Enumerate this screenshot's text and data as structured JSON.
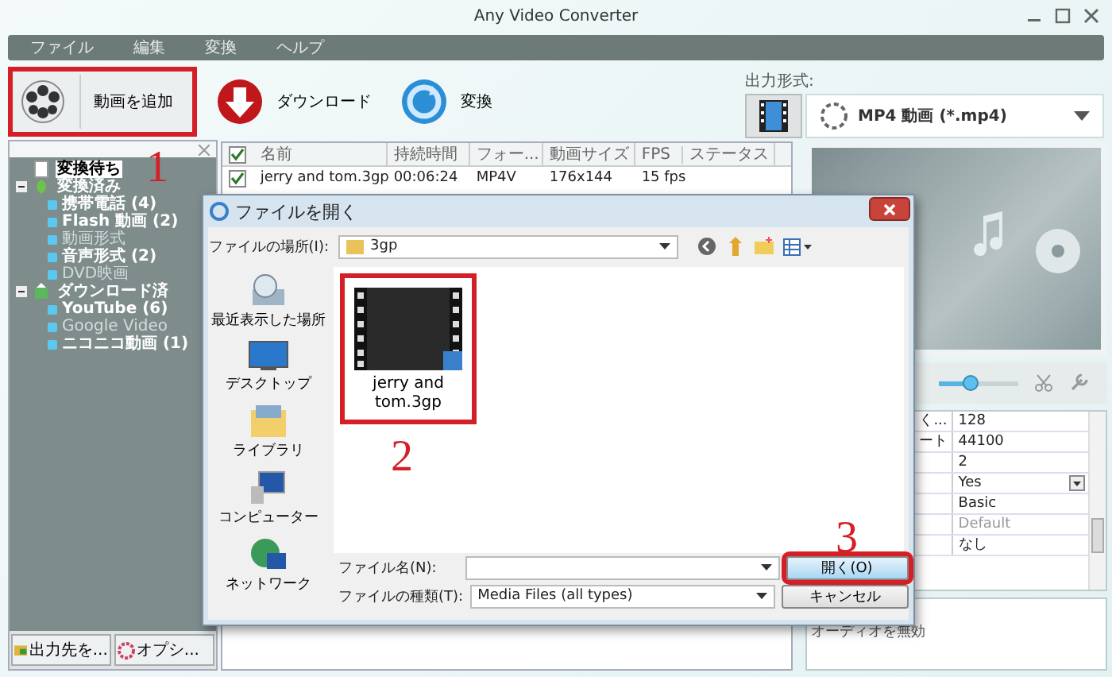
{
  "window": {
    "title": "Any Video Converter"
  },
  "menu": [
    "ファイル",
    "編集",
    "変換",
    "ヘルプ"
  ],
  "toolbar": [
    {
      "kind": "add",
      "label": "動画を追加"
    },
    {
      "kind": "download",
      "label": "ダウンロード"
    },
    {
      "kind": "convert",
      "label": "変換"
    }
  ],
  "output_format": {
    "label": "出力形式:",
    "value": "MP4 動画 (*.mp4)"
  },
  "tree": [
    {
      "label": "変換待ち",
      "selected": true,
      "expanded": false
    },
    {
      "label": "変換済み",
      "selected": false,
      "expanded": true,
      "children": [
        {
          "label": "携帯電話 (4)",
          "dimmed": false
        },
        {
          "label": "Flash 動画 (2)",
          "dimmed": false
        },
        {
          "label": "動画形式",
          "dimmed": true
        },
        {
          "label": "音声形式 (2)",
          "dimmed": false
        },
        {
          "label": "DVD映画",
          "dimmed": true
        }
      ]
    },
    {
      "label": "ダウンロード済",
      "selected": false,
      "expanded": true,
      "children": [
        {
          "label": "YouTube (6)",
          "dimmed": false
        },
        {
          "label": "Google Video",
          "dimmed": true
        },
        {
          "label": "ニコニコ動画 (1)",
          "dimmed": false
        }
      ]
    }
  ],
  "left_buttons": [
    {
      "kind": "folder",
      "label": "出力先を..."
    },
    {
      "kind": "gear",
      "label": "オプシ..."
    }
  ],
  "table": {
    "all_checked": true,
    "columns": [
      "名前",
      "持続時間",
      "フォー...",
      "動画サイズ",
      "FPS",
      "ステータス"
    ],
    "rows": [
      {
        "checked": true,
        "cells": [
          "jerry and tom.3gp",
          "00:06:24",
          "MP4V",
          "176x144",
          "15 fps",
          ""
        ]
      }
    ]
  },
  "player": {
    "volume": {
      "level": 0.4
    }
  },
  "properties": [
    {
      "label": "く...",
      "value": "128",
      "kind": "text",
      "dimmed": false
    },
    {
      "label": "ート",
      "value": "44100",
      "kind": "text",
      "dimmed": false
    },
    {
      "value": "2",
      "kind": "text",
      "dimmed": false
    },
    {
      "value": "Yes",
      "kind": "dropdown",
      "dimmed": false
    },
    {
      "value": "Basic",
      "kind": "text",
      "dimmed": false
    },
    {
      "value": "Default",
      "kind": "text",
      "dimmed": true
    },
    {
      "value": "なし",
      "kind": "text",
      "dimmed": false
    }
  ],
  "property_description": "オーディオを無効",
  "dialog": {
    "title": "ファイルを開く",
    "location_label": "ファイルの場所(I):",
    "location": "3gp",
    "places": [
      {
        "kind": "recent",
        "label": "最近表示した場所"
      },
      {
        "kind": "desktop",
        "label": "デスクトップ"
      },
      {
        "kind": "library",
        "label": "ライブラリ"
      },
      {
        "kind": "computer",
        "label": "コンピューター"
      },
      {
        "kind": "network",
        "label": "ネットワーク"
      }
    ],
    "files": [
      {
        "name": "jerry and tom.3gp"
      }
    ],
    "filename_label": "ファイル名(N):",
    "filetype_label": "ファイルの種類(T):",
    "filetype": "Media Files (all types)",
    "buttons": [
      {
        "kind": "open",
        "label": "開く(O)"
      },
      {
        "kind": "cancel",
        "label": "キャンセル"
      }
    ]
  },
  "annotations": [
    "1",
    "2",
    "3"
  ]
}
